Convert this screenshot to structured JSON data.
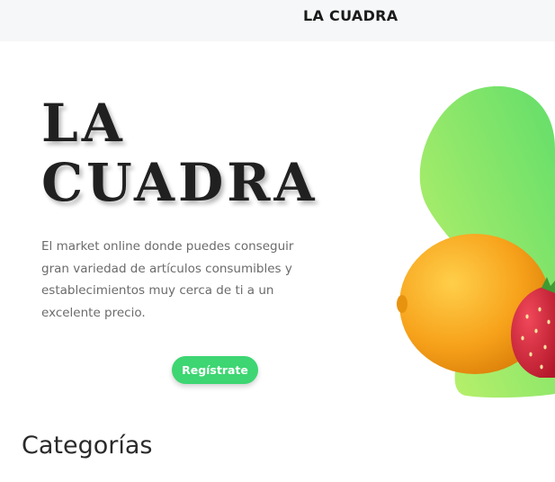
{
  "header": {
    "brand": "LA CUADRA"
  },
  "hero": {
    "title_line1": "LA",
    "title_line2": "CUADRA",
    "description": "El market online donde puedes conseguir gran variedad de artículos consumibles y establecimientos muy cerca de ti a un excelente precio.",
    "cta_label": "Regístrate"
  },
  "sections": {
    "categories_title": "Categorías"
  },
  "colors": {
    "accent": "#3dd672",
    "blob_light": "#c3f26a",
    "blob_dark": "#62de6a",
    "lemon": "#f7a21b",
    "strawberry": "#d9283b"
  },
  "icons": {
    "hero_art": "lemon-strawberry-illustration"
  }
}
